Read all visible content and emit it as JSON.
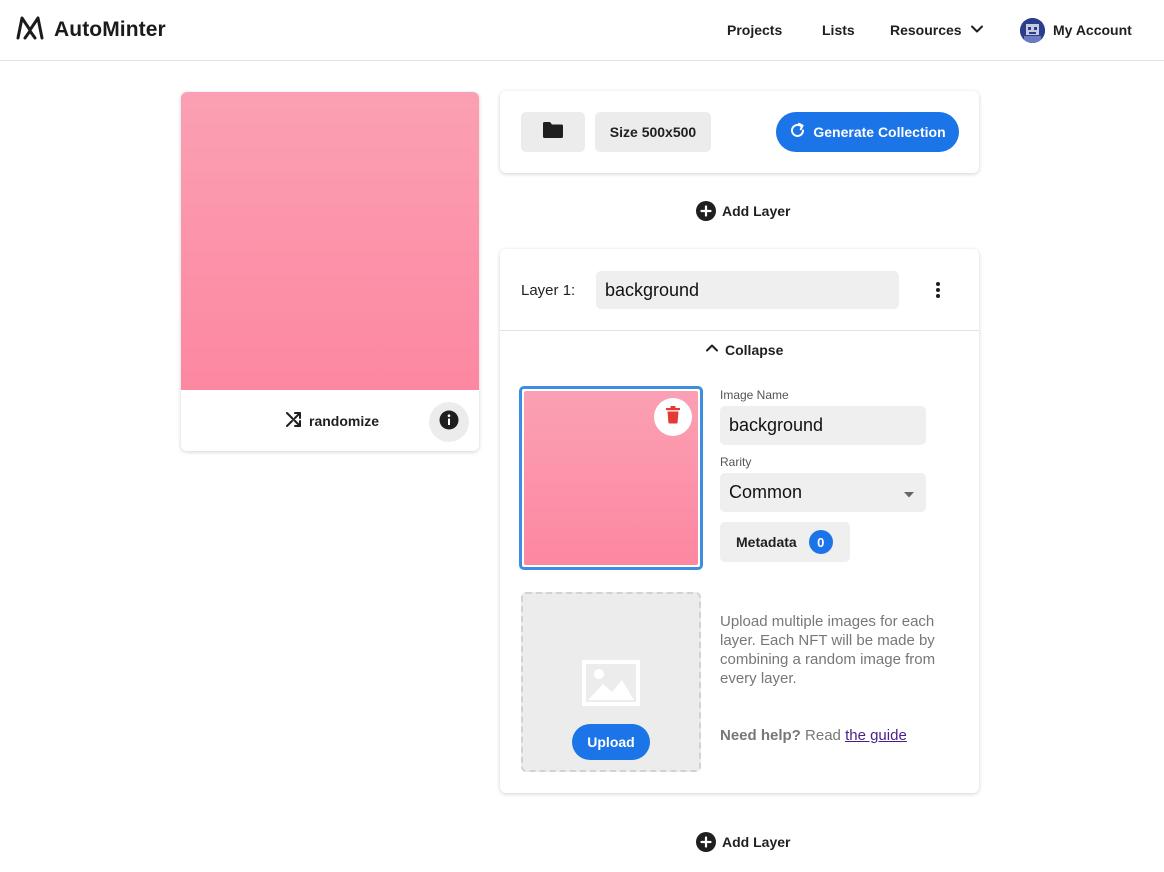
{
  "header": {
    "brand": "AutoMinter",
    "nav": {
      "projects": "Projects",
      "lists": "Lists",
      "resources": "Resources",
      "account": "My Account"
    }
  },
  "preview": {
    "randomize_label": "randomize",
    "gradient": [
      "#fba0b4",
      "#fd87a1"
    ]
  },
  "toolbar": {
    "size_label": "Size 500x500",
    "generate_label": "Generate Collection"
  },
  "add_layer_label": "Add Layer",
  "layer": {
    "label": "Layer 1:",
    "name_value": "background",
    "collapse_label": "Collapse",
    "image": {
      "name_label": "Image Name",
      "name_value": "background",
      "rarity_label": "Rarity",
      "rarity_value": "Common",
      "metadata_label": "Metadata",
      "metadata_count": "0"
    },
    "upload": {
      "button_label": "Upload",
      "help_text": "Upload multiple images for each layer. Each NFT will be made by combining a random image from every layer.",
      "need_help": "Need help?",
      "read": "Read",
      "guide_link": "the guide"
    }
  },
  "colors": {
    "accent": "#1b74e8",
    "delete": "#e53935",
    "selected_border": "#3d8ee0"
  }
}
